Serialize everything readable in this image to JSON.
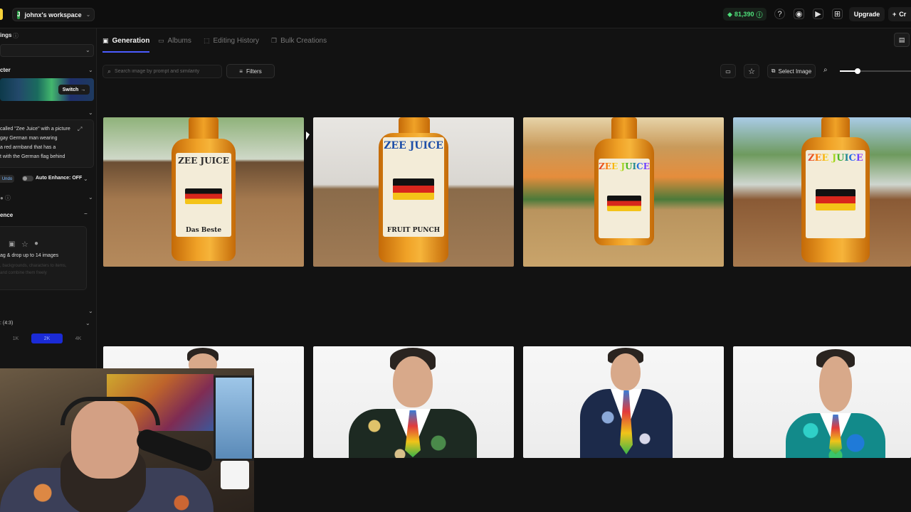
{
  "topbar": {
    "workspace_initial": "J",
    "workspace_name": "johnx's workspace",
    "credits": "81,390",
    "upgrade_label": "Upgrade",
    "create_label": "Cr"
  },
  "sidebar": {
    "settings_title": "ings",
    "character_title": "cter",
    "switch_label": "Switch",
    "prompt_lines": [
      "called \"Zee Juice\" with a picture",
      "gay German man wearing",
      "a red armband that has a",
      "t with the German flag behind"
    ],
    "undo_label": "Undo",
    "auto_enhance_label": "Auto Enhance: OFF",
    "reference_title": "ence",
    "upload_hint": "ag & drop up to 14 images",
    "upload_subhint_1": ", backgrounds, characters to items,",
    "upload_subhint_2": "and combine them freely",
    "aspect_ratio": ": (4:3)",
    "resolutions": [
      "1K",
      "2K",
      "4K"
    ],
    "resolution_selected": "2K"
  },
  "tabs": [
    {
      "label": "Generation",
      "active": true,
      "icon": "image-icon"
    },
    {
      "label": "Albums",
      "active": false,
      "icon": "folder-icon"
    },
    {
      "label": "Editing History",
      "active": false,
      "icon": "history-icon"
    },
    {
      "label": "Bulk Creations",
      "active": false,
      "icon": "stack-icon"
    }
  ],
  "toolbar": {
    "search_placeholder": "Search image by prompt and similarity",
    "filters_label": "Filters",
    "select_image_label": "Select Image",
    "zoom_level": 0.25
  },
  "gallery": {
    "row1": [
      {
        "title": "ZEE JUICE",
        "subtitle": "Das Beste"
      },
      {
        "title": "ZEE JUICE",
        "subtitle": "FRUIT PUNCH"
      },
      {
        "title": "ZEE JUICE",
        "subtitle": ""
      },
      {
        "title": "ZEE JUICE",
        "subtitle": ""
      }
    ]
  },
  "colors": {
    "accent": "#4b5bff",
    "credits_green": "#4ee07a",
    "resolution_active": "#1b2bd6"
  }
}
